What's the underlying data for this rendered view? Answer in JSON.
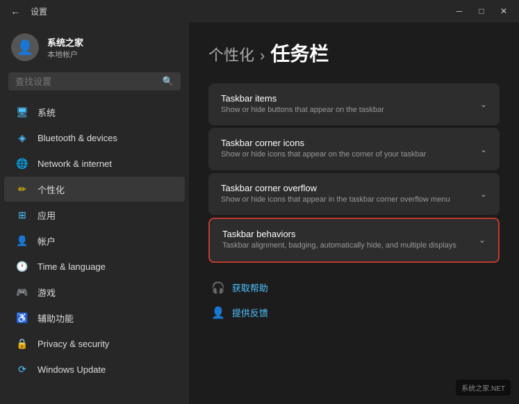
{
  "titlebar": {
    "title": "设置",
    "minimize": "─",
    "maximize": "□",
    "close": "✕"
  },
  "user": {
    "name": "系统之家",
    "subtitle": "本地帐户"
  },
  "search": {
    "placeholder": "查找设置"
  },
  "nav": {
    "items": [
      {
        "id": "system",
        "label": "系统",
        "icon": "🖥",
        "iconClass": "system",
        "active": false
      },
      {
        "id": "bluetooth",
        "label": "Bluetooth & devices",
        "icon": "⬟",
        "iconClass": "bluetooth",
        "active": false
      },
      {
        "id": "network",
        "label": "Network & internet",
        "icon": "🌐",
        "iconClass": "network",
        "active": false
      },
      {
        "id": "personalization",
        "label": "个性化",
        "icon": "✏",
        "iconClass": "personalization",
        "active": true
      },
      {
        "id": "apps",
        "label": "应用",
        "icon": "⊞",
        "iconClass": "apps",
        "active": false
      },
      {
        "id": "accounts",
        "label": "帐户",
        "icon": "👤",
        "iconClass": "accounts",
        "active": false
      },
      {
        "id": "time",
        "label": "Time & language",
        "icon": "🕐",
        "iconClass": "time",
        "active": false
      },
      {
        "id": "gaming",
        "label": "游戏",
        "icon": "🎮",
        "iconClass": "gaming",
        "active": false
      },
      {
        "id": "accessibility",
        "label": "辅助功能",
        "icon": "♿",
        "iconClass": "accessibility",
        "active": false
      },
      {
        "id": "privacy",
        "label": "Privacy & security",
        "icon": "🔒",
        "iconClass": "privacy",
        "active": false
      },
      {
        "id": "update",
        "label": "Windows Update",
        "icon": "⟳",
        "iconClass": "update",
        "active": false
      }
    ]
  },
  "page": {
    "breadcrumb": "个性化",
    "separator": "›",
    "title": "任务栏"
  },
  "cards": [
    {
      "id": "taskbar-items",
      "title": "Taskbar items",
      "desc": "Show or hide buttons that appear on the taskbar",
      "highlighted": false
    },
    {
      "id": "taskbar-corner-icons",
      "title": "Taskbar corner icons",
      "desc": "Show or hide icons that appear on the corner of your taskbar",
      "highlighted": false
    },
    {
      "id": "taskbar-corner-overflow",
      "title": "Taskbar corner overflow",
      "desc": "Show or hide icons that appear in the taskbar corner overflow menu",
      "highlighted": false
    },
    {
      "id": "taskbar-behaviors",
      "title": "Taskbar behaviors",
      "desc": "Taskbar alignment, badging, automatically hide, and multiple displays",
      "highlighted": true
    }
  ],
  "help": {
    "get_help_label": "获取帮助",
    "feedback_label": "提供反馈"
  },
  "watermark": "系统之家.NET"
}
